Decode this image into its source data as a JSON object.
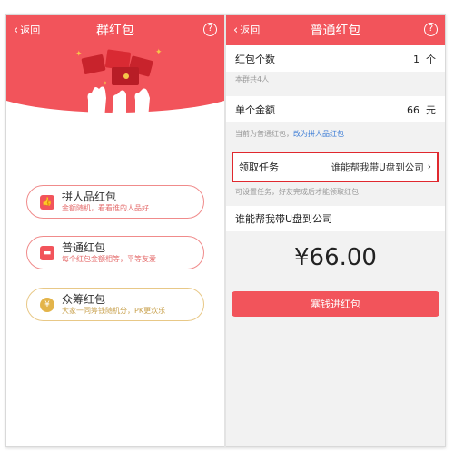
{
  "left": {
    "back_label": "返回",
    "title": "群红包",
    "help_label": "?",
    "options": [
      {
        "icon": "thumb-up-icon",
        "glyph": "👍",
        "title": "拼人品红包",
        "subtitle": "金额随机，看看谁的人品好"
      },
      {
        "icon": "envelope-icon",
        "glyph": "▬",
        "title": "普通红包",
        "subtitle": "每个红包金额相等，平等友爱"
      },
      {
        "icon": "coin-icon",
        "glyph": "¥",
        "title": "众筹红包",
        "subtitle": "大家一同筹钱随机分，PK更欢乐"
      }
    ]
  },
  "right": {
    "back_label": "返回",
    "title": "普通红包",
    "help_label": "?",
    "count_label": "红包个数",
    "count_value": "1",
    "count_unit": "个",
    "count_note": "本群共4人",
    "amount_label": "单个金额",
    "amount_value": "66",
    "amount_unit": "元",
    "amount_note_prefix": "当前为普通红包，",
    "amount_note_link": "改为拼人品红包",
    "task_label": "领取任务",
    "task_value": "谁能帮我带U盘到公司",
    "task_note": "可设置任务，好友完成后才能领取红包",
    "message_value": "谁能帮我带U盘到公司",
    "total_display": "¥66.00",
    "submit_label": "塞钱进红包"
  },
  "colors": {
    "brand_red": "#f2545b",
    "highlight_red": "#e0282e",
    "gold": "#e3b44a",
    "link_blue": "#3a7bd5"
  }
}
